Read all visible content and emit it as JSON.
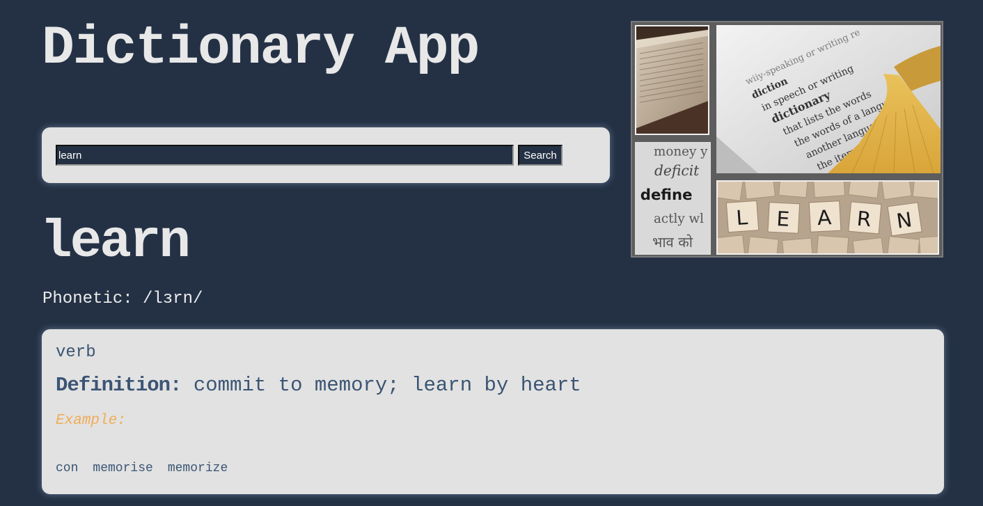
{
  "header": {
    "title": "Dictionary App"
  },
  "search": {
    "value": "learn",
    "button_label": "Search"
  },
  "result": {
    "word": "learn",
    "phonetic": "Phonetic: /lɜrn/",
    "meanings": [
      {
        "part_of_speech": "verb",
        "definition_label": "Definition:",
        "definition": "commit to memory; learn by heart",
        "example_label": "Example:",
        "synonyms": [
          "con",
          "memorise",
          "memorize"
        ]
      }
    ]
  },
  "collage": {
    "tiles": [
      {
        "icon": "open-book-image"
      },
      {
        "icon": "define-text-image",
        "text_lines": [
          "money y",
          "deficit",
          "define",
          "actly wl",
          "भाव को"
        ]
      },
      {
        "icon": "dictionary-tassel-image"
      },
      {
        "icon": "scrabble-tiles-image",
        "letters": [
          "L",
          "E",
          "A",
          "R",
          "N"
        ]
      }
    ]
  },
  "colors": {
    "background": "#243145",
    "panel": "#e2e2e2",
    "text_blue": "#3b5574",
    "example_orange": "#f0ac58",
    "title_text": "#e8e8e8"
  }
}
